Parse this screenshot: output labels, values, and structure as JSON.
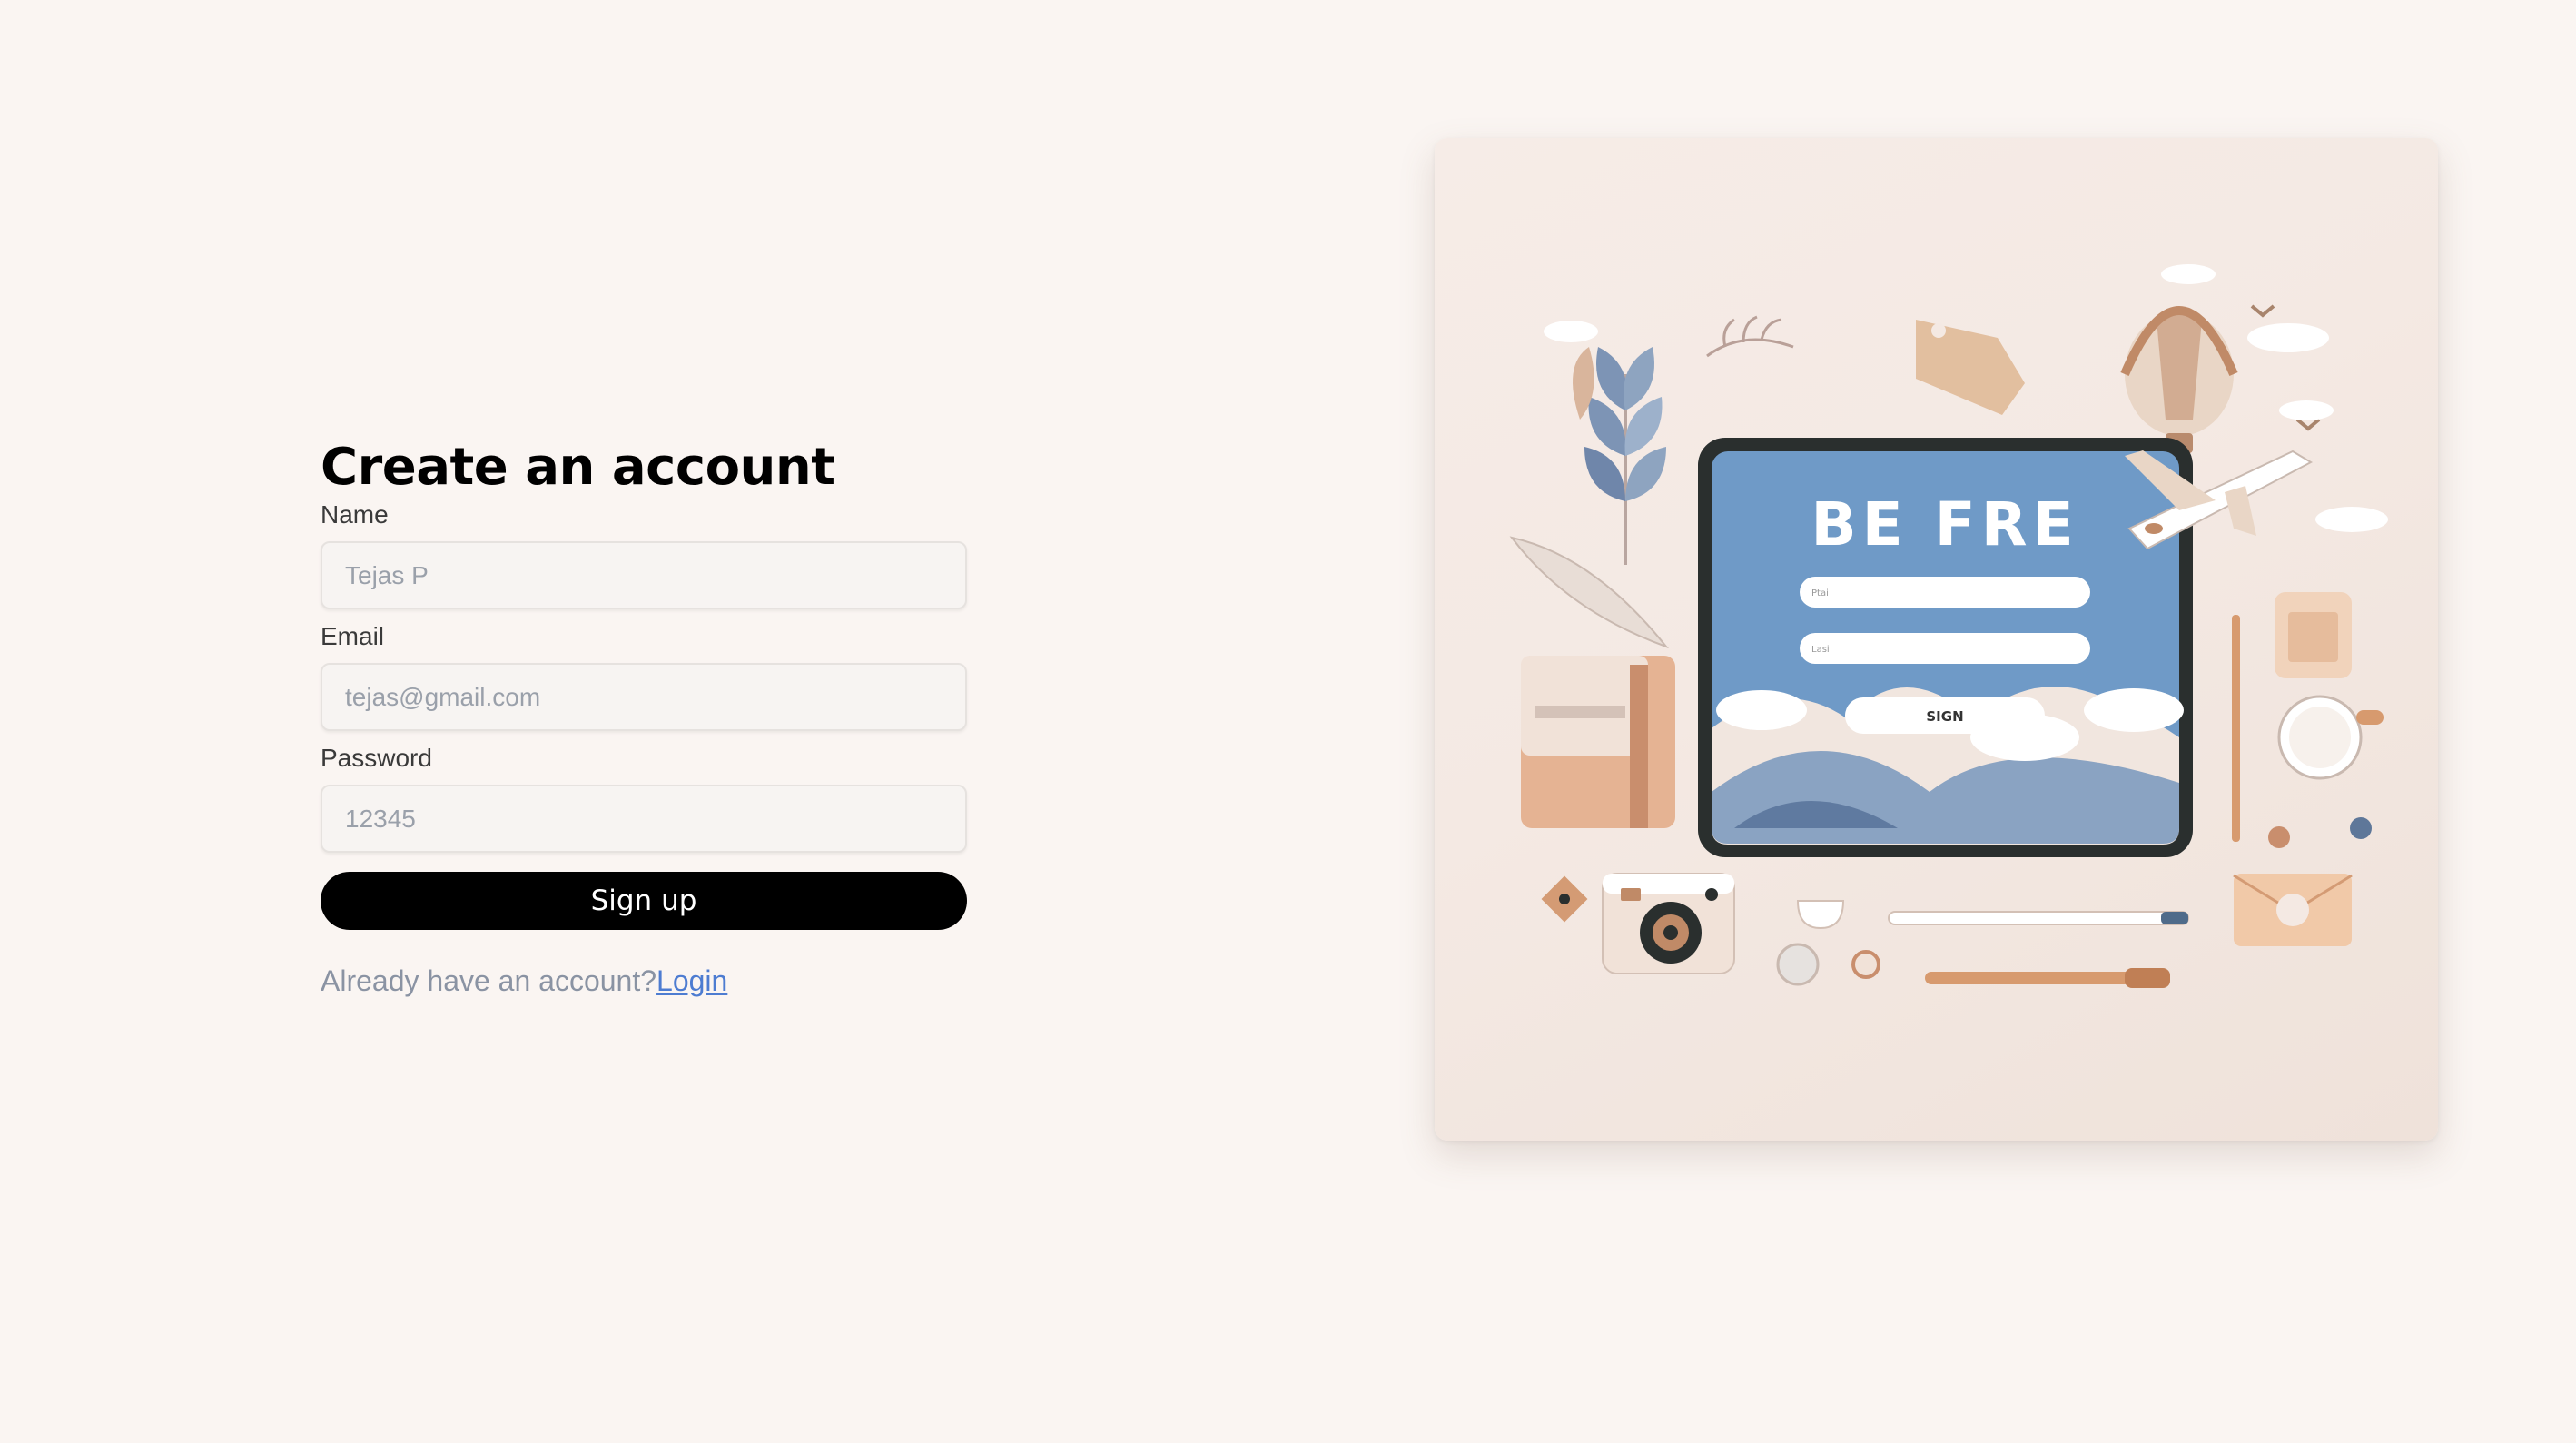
{
  "form": {
    "title": "Create an account",
    "name_label": "Name",
    "name_placeholder": "Tejas P",
    "email_label": "Email",
    "email_placeholder": "tejas@gmail.com",
    "password_label": "Password",
    "password_placeholder": "12345",
    "signup_label": "Sign up",
    "already_text": "Already have an account?",
    "login_label": "Login"
  },
  "illustration": {
    "tablet_heading": "BE FRE",
    "tablet_field1": "Ptai",
    "tablet_field2": "Lasi",
    "tablet_button": "SIGN"
  },
  "colors": {
    "background": "#faf5f2",
    "button": "#000000",
    "link": "#4d7cd1",
    "tablet_screen": "#6f9ac7"
  }
}
